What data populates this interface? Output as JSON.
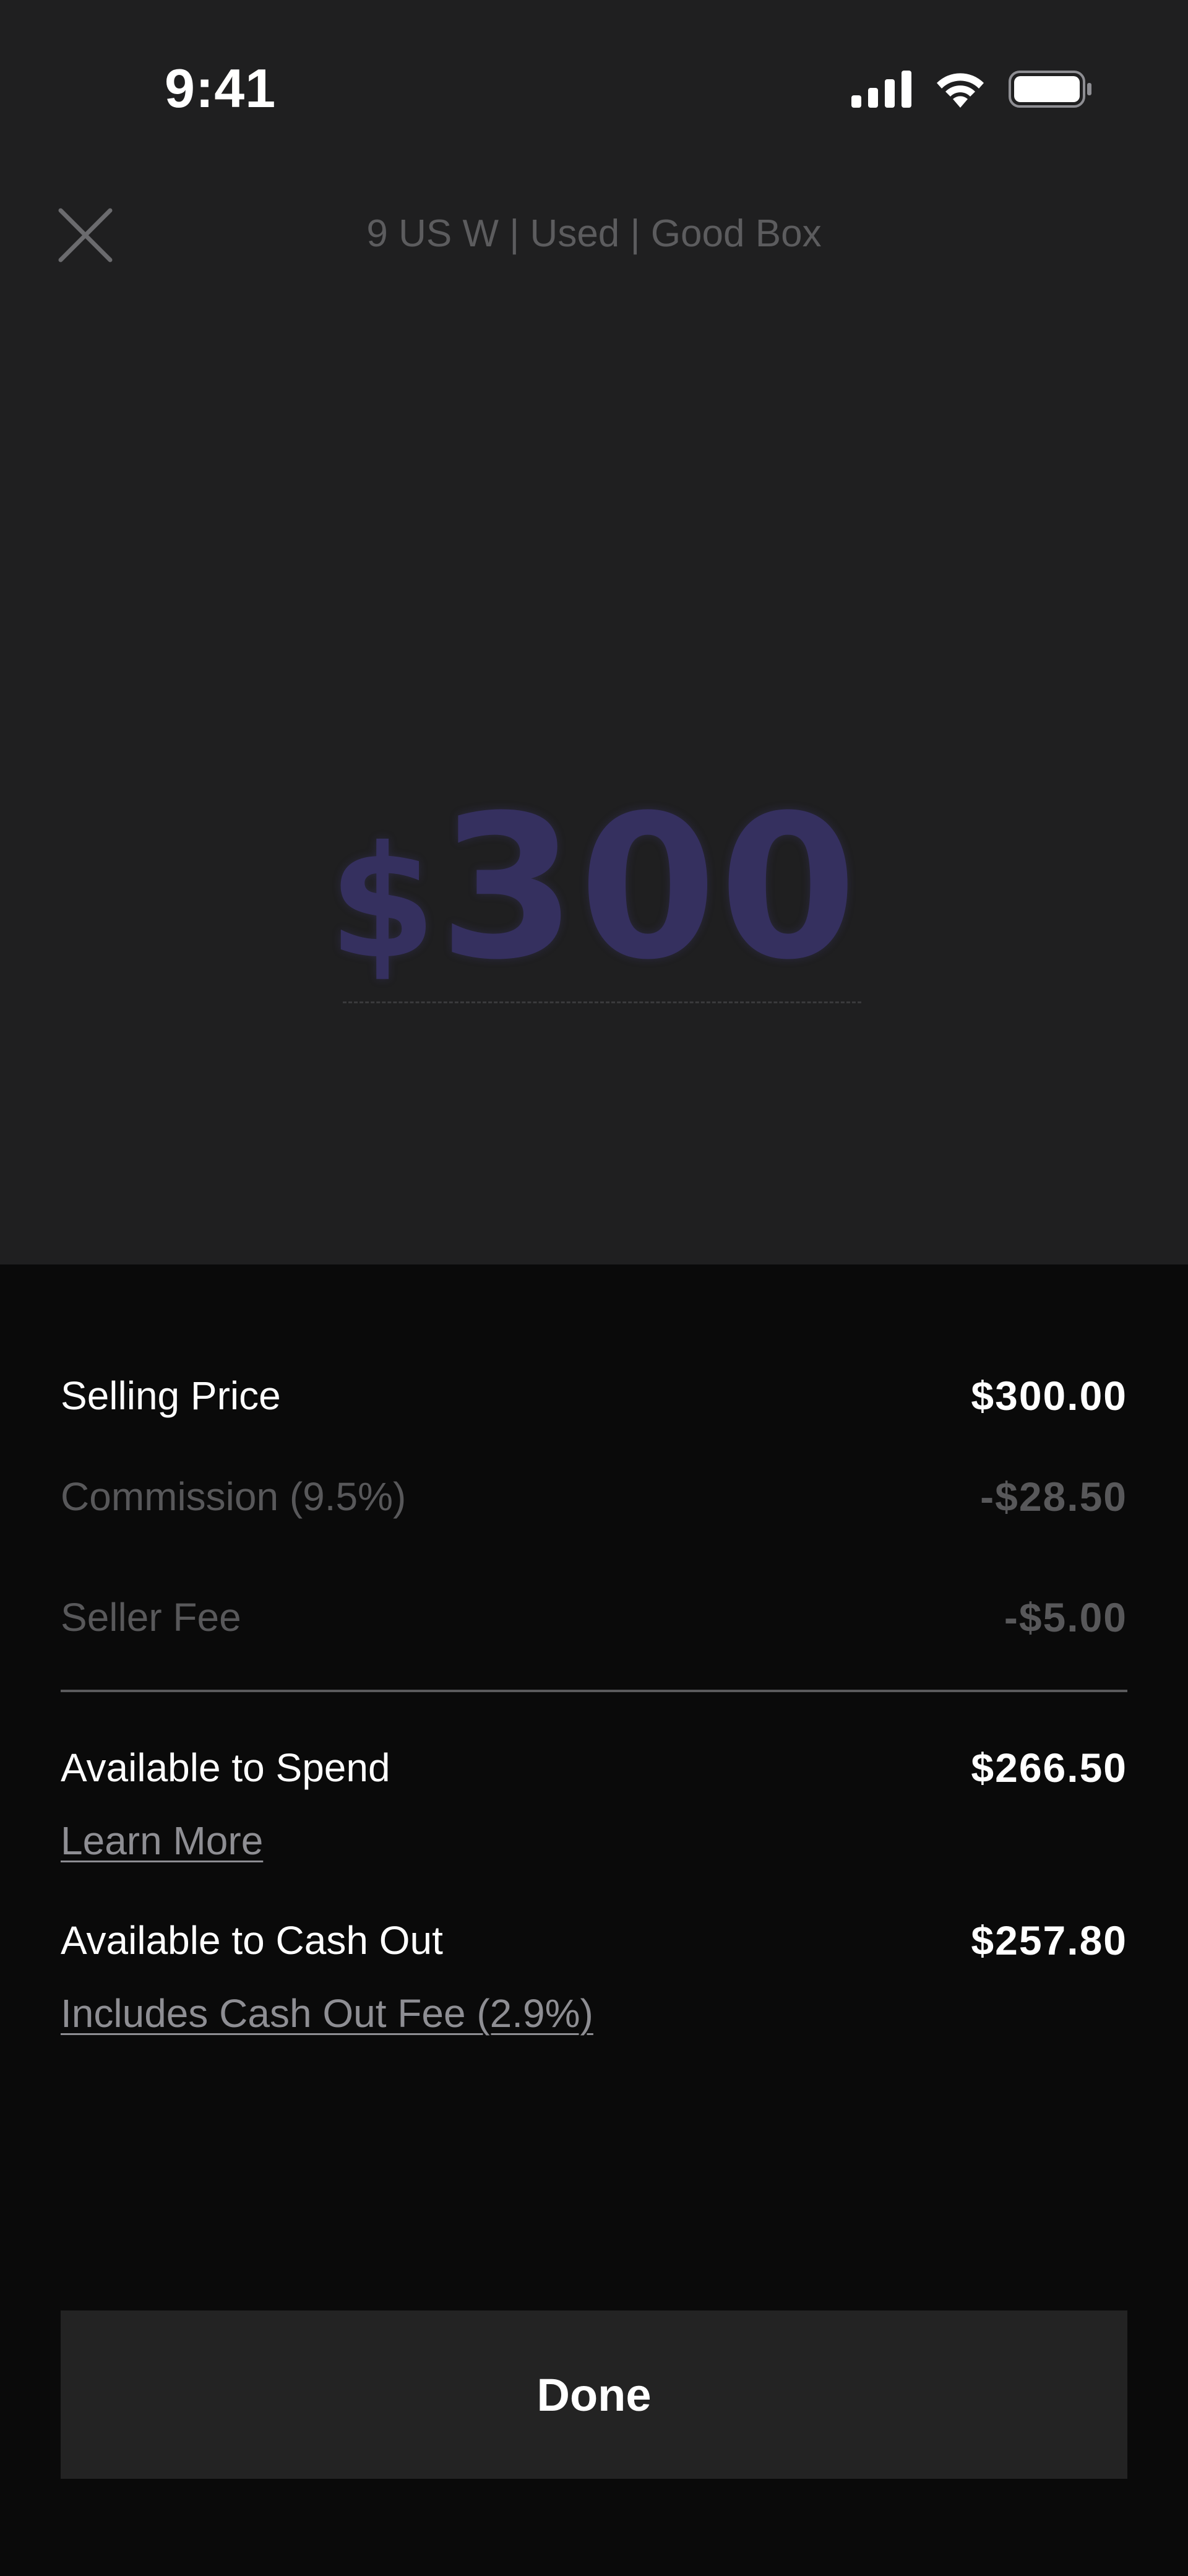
{
  "status_bar": {
    "time": "9:41",
    "icons": [
      "signal-icon",
      "wifi-icon",
      "battery-icon"
    ]
  },
  "header": {
    "close_icon": "close-icon",
    "title": "9 US W | Used | Good Box"
  },
  "price_input": {
    "currency_symbol": "$",
    "amount": "300",
    "color": "#35305f"
  },
  "breakdown": {
    "selling_price": {
      "label": "Selling Price",
      "value": "$300.00"
    },
    "commission": {
      "label": "Commission (9.5%)",
      "value": "-$28.50"
    },
    "seller_fee": {
      "label": "Seller Fee",
      "value": "-$5.00"
    },
    "available_to_spend": {
      "label": "Available to Spend",
      "value": "$266.50",
      "link": "Learn More"
    },
    "available_to_cash_out": {
      "label": "Available to Cash Out",
      "value": "$257.80",
      "link": "Includes Cash Out Fee (2.9%)"
    }
  },
  "actions": {
    "done_label": "Done"
  },
  "colors": {
    "background_top": "#1f1f20",
    "background_sheet": "#0a0a0a",
    "button_bg": "#232323",
    "muted_text": "#58585a",
    "link_text": "#8e8e93"
  }
}
